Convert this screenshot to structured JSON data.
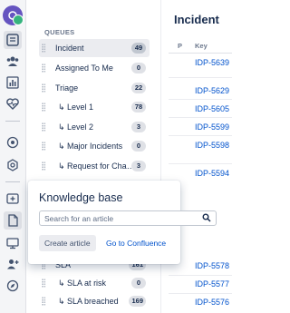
{
  "sidebar": {
    "heading": "QUEUES",
    "items": [
      {
        "label": "Incident",
        "count": "49",
        "sub": false,
        "selected": true
      },
      {
        "label": "Assigned To Me",
        "count": "0",
        "sub": false
      },
      {
        "label": "Triage",
        "count": "22",
        "sub": false
      },
      {
        "label": "↳ Level 1",
        "count": "78",
        "sub": true
      },
      {
        "label": "↳ Level 2",
        "count": "3",
        "sub": true
      },
      {
        "label": "↳ Major Incidents",
        "count": "0",
        "sub": true
      },
      {
        "label": "↳ Request for Cha…",
        "count": "3",
        "sub": true
      },
      {
        "label": "SLA",
        "count": "161",
        "sub": false
      },
      {
        "label": "↳ SLA at risk",
        "count": "0",
        "sub": true
      },
      {
        "label": "↳ SLA breached",
        "count": "169",
        "sub": true
      }
    ]
  },
  "main": {
    "title": "Incident",
    "columns": {
      "p": "P",
      "key": "Key"
    },
    "issues": [
      "IDP-5639",
      "IDP-5629",
      "IDP-5605",
      "IDP-5599",
      "IDP-5598",
      "IDP-5594",
      "IDP-5578",
      "IDP-5577",
      "IDP-5576"
    ]
  },
  "kb_popup": {
    "title": "Knowledge base",
    "search_placeholder": "Search for an article",
    "create_label": "Create article",
    "confluence_label": "Go to Confluence"
  },
  "colors": {
    "accent": "#0052cc",
    "selected_bg": "#ebecf0",
    "avatar": "#6554c0",
    "badge": "#36b37e"
  }
}
